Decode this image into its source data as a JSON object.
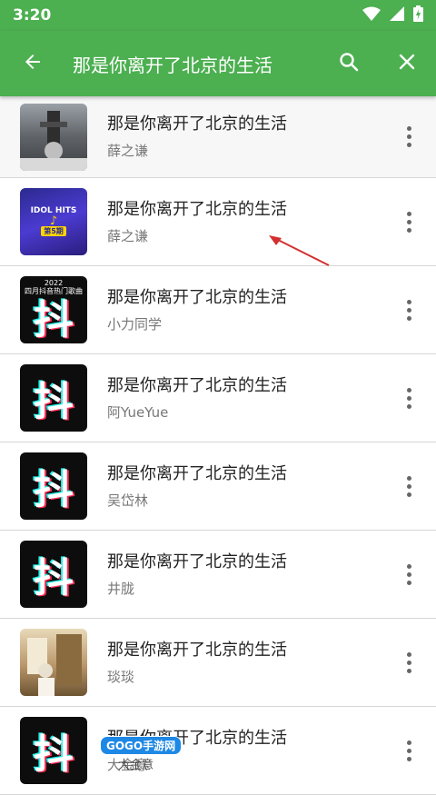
{
  "status_bar": {
    "time": "3:20"
  },
  "toolbar": {
    "title": "那是你离开了北京的生活"
  },
  "songs": [
    {
      "title": "那是你离开了北京的生活",
      "artist": "薛之谦",
      "thumb": "photo-grey"
    },
    {
      "title": "那是你离开了北京的生活",
      "artist": "薛之谦",
      "thumb": "idol-hits"
    },
    {
      "title": "那是你离开了北京的生活",
      "artist": "小力同学",
      "thumb": "douyin"
    },
    {
      "title": "那是你离开了北京的生活",
      "artist": "阿YueYue",
      "thumb": "douyin"
    },
    {
      "title": "那是你离开了北京的生活",
      "artist": "吴岱林",
      "thumb": "douyin"
    },
    {
      "title": "那是你离开了北京的生活",
      "artist": "井胧",
      "thumb": "douyin"
    },
    {
      "title": "那是你离开了北京的生活",
      "artist": "琰琰",
      "thumb": "photo-warm"
    },
    {
      "title": "那是你离开了北京的生活",
      "artist": "大金意",
      "thumb": "douyin"
    }
  ],
  "thumb_captions": {
    "row3": "2022\n四月抖音热门歌曲",
    "idol_top": "IDOL HITS",
    "idol_badge": "第5期"
  },
  "watermark": {
    "logo": "GOGO手游网",
    "sub": "大金意"
  },
  "icons": {
    "back": "arrow-left-icon",
    "search": "search-icon",
    "close": "close-icon",
    "more": "more-vert-icon",
    "wifi": "wifi-icon",
    "signal": "signal-icon",
    "battery": "battery-charging-icon"
  },
  "colors": {
    "primary": "#4caf50",
    "annotation": "#d32f2f"
  }
}
